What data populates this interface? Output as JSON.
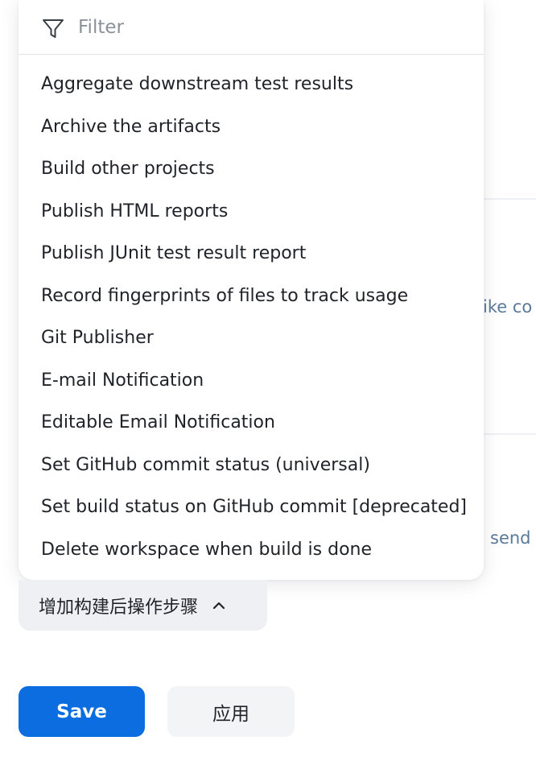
{
  "background": {
    "partial_text_1": "ike co",
    "partial_text_2": "send"
  },
  "dropdown": {
    "filter": {
      "icon": "filter-icon",
      "placeholder": "Filter",
      "value": ""
    },
    "items": [
      {
        "label": "Aggregate downstream test results"
      },
      {
        "label": "Archive the artifacts"
      },
      {
        "label": "Build other projects"
      },
      {
        "label": "Publish HTML reports"
      },
      {
        "label": "Publish JUnit test result report"
      },
      {
        "label": "Record fingerprints of files to track usage"
      },
      {
        "label": "Git Publisher"
      },
      {
        "label": "E-mail Notification"
      },
      {
        "label": "Editable Email Notification"
      },
      {
        "label": "Set GitHub commit status (universal)"
      },
      {
        "label": "Set build status on GitHub commit [deprecated]"
      },
      {
        "label": "Delete workspace when build is done"
      }
    ]
  },
  "add_step_button": {
    "label": "增加构建后操作步骤",
    "icon": "chevron-up-icon"
  },
  "actions": {
    "save_label": "Save",
    "apply_label": "应用"
  },
  "colors": {
    "primary": "#0b6de0",
    "secondary_bg": "#f3f4f6",
    "text": "#1f2328",
    "muted_link": "#5b7a99"
  }
}
